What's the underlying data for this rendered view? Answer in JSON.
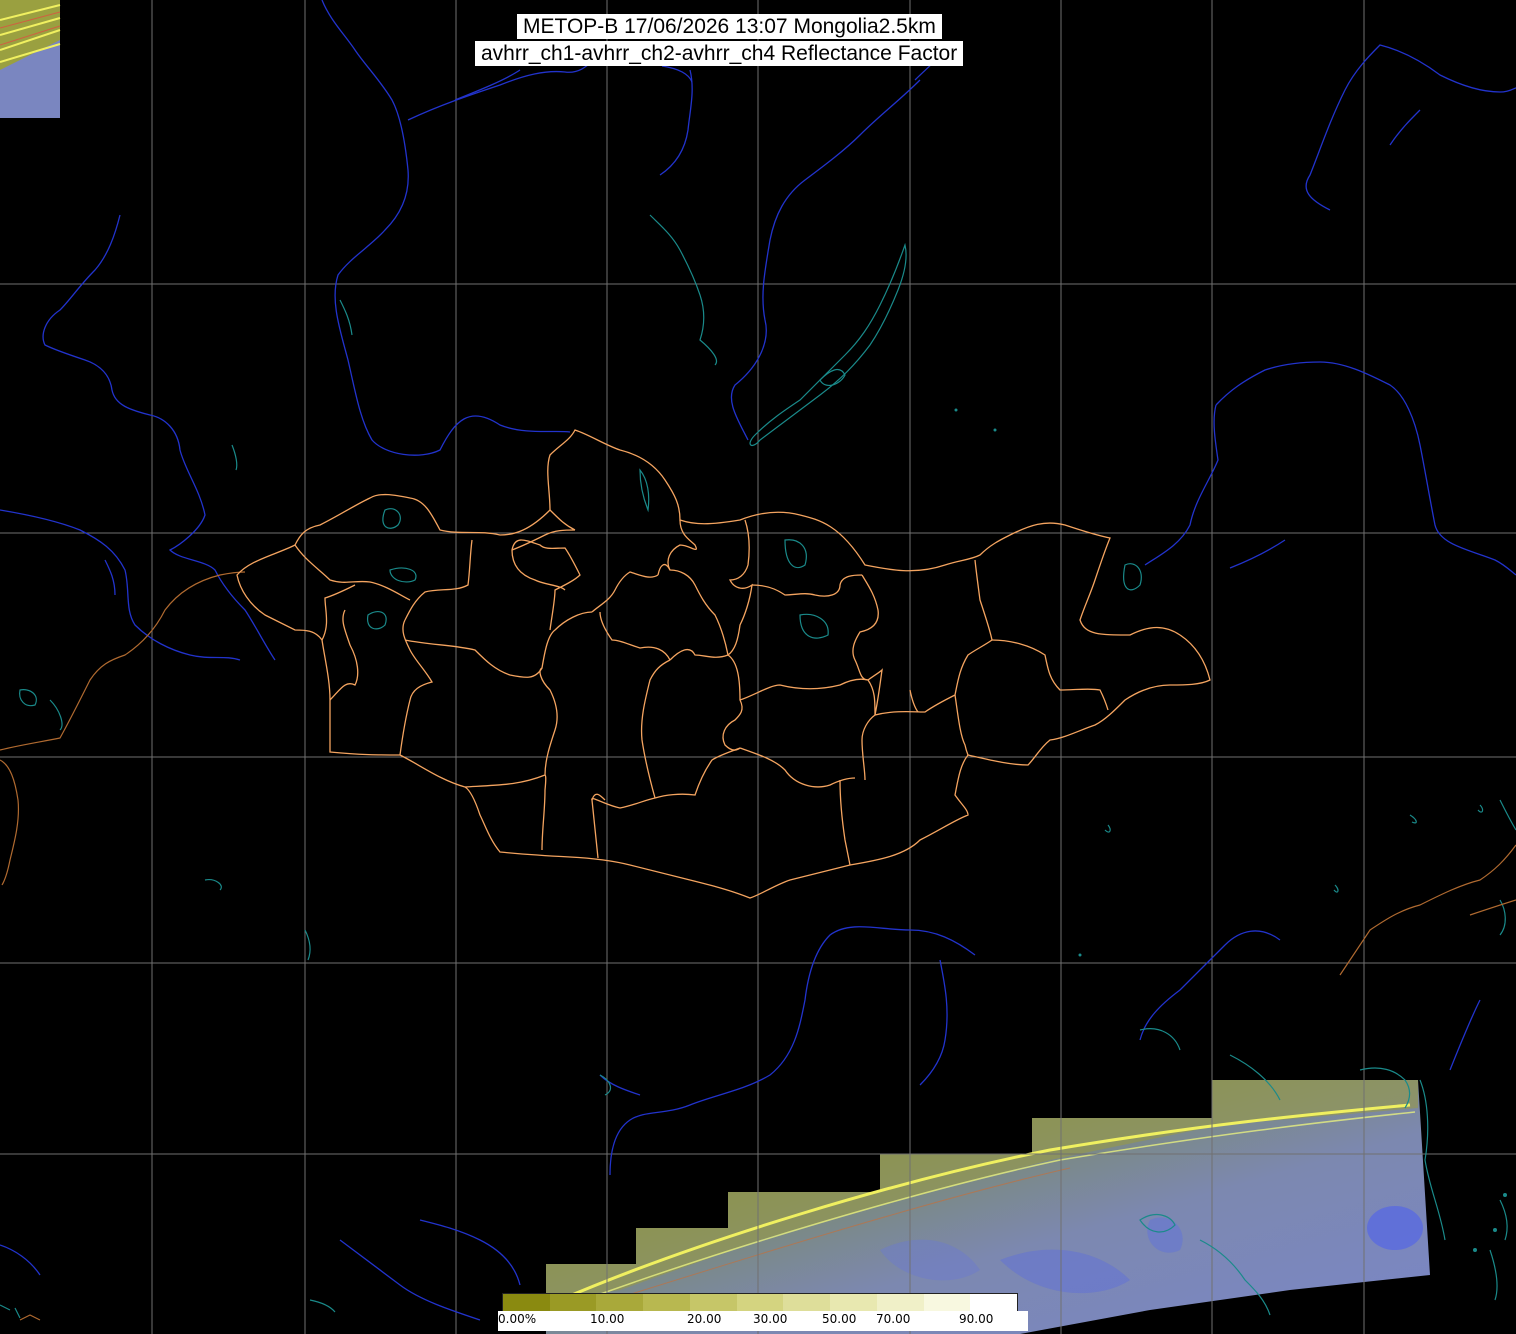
{
  "header": {
    "line1": "METOP-B 17/06/2026 13:07 Mongolia2.5km",
    "line2": "avhrr_ch1-avhrr_ch2-avhrr_ch4 Reflectance Factor"
  },
  "legend": {
    "ticks": [
      {
        "label": "0.00%",
        "value": 0
      },
      {
        "label": "10.00",
        "value": 10
      },
      {
        "label": "20.00",
        "value": 20
      },
      {
        "label": "30.00",
        "value": 30
      },
      {
        "label": "50.00",
        "value": 50
      },
      {
        "label": "70.00",
        "value": 70
      },
      {
        "label": "90.00",
        "value": 90
      }
    ],
    "colors": [
      "#8a8a10",
      "#9a9a25",
      "#a9a93a",
      "#b8b850",
      "#c6c668",
      "#d4d480",
      "#dede9a",
      "#e8e8b0",
      "#f0f0c8",
      "#f8f8e0",
      "#ffffff"
    ]
  },
  "colors": {
    "background": "#000000",
    "grid": "#707070",
    "rivers": "#2233cc",
    "lakes_coast": "#1a8a8a",
    "admin_borders": "#f4a460",
    "intl_borders": "#b06a30"
  }
}
